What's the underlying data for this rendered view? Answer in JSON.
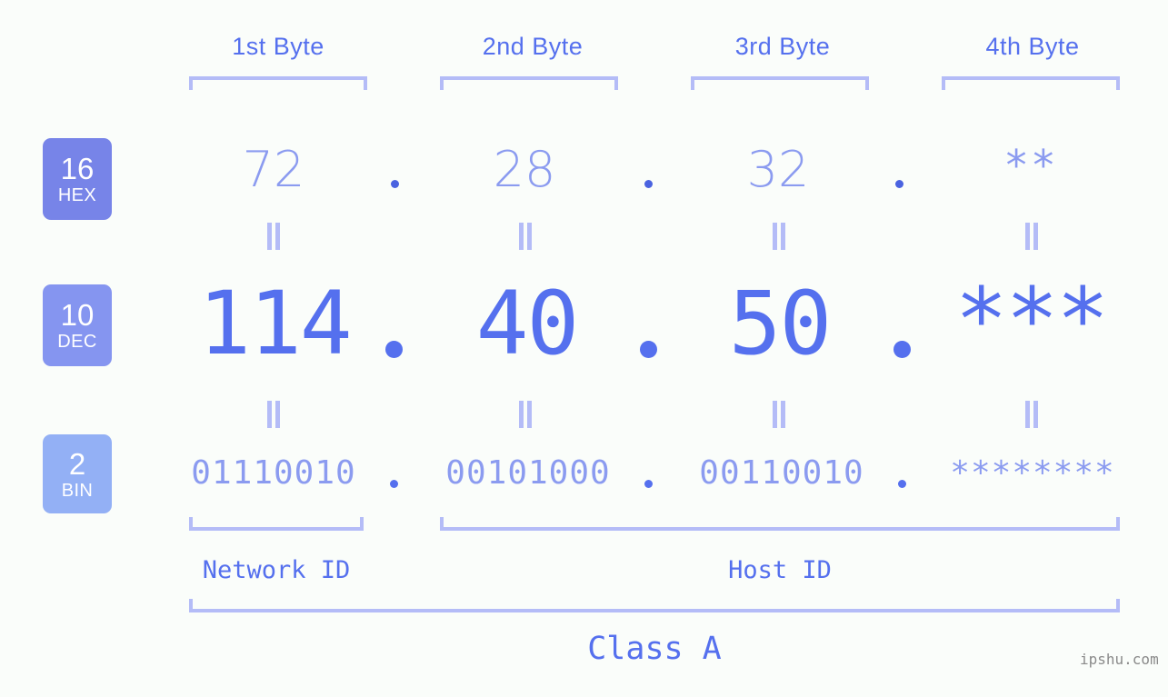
{
  "background_color": "#fafdfa",
  "colors": {
    "accent_strong": "#5570ee",
    "accent_light": "#8b9bf0",
    "bracket": "#b4bcf7",
    "badge_hex": "#7784e8",
    "badge_dec": "#8595f0",
    "badge_bin": "#93b0f5",
    "watermark": "#8a8a8a"
  },
  "header": {
    "byte_labels": [
      {
        "text": "1st Byte"
      },
      {
        "text": "2nd Byte"
      },
      {
        "text": "3rd Byte"
      },
      {
        "text": "4th Byte"
      }
    ]
  },
  "rows": [
    {
      "badge": {
        "num": "16",
        "sub": "HEX"
      },
      "values": [
        "72",
        "28",
        "32",
        "**"
      ],
      "separator": "."
    },
    {
      "badge": {
        "num": "10",
        "sub": "DEC"
      },
      "values": [
        "114",
        "40",
        "50",
        "***"
      ],
      "separator": "."
    },
    {
      "badge": {
        "num": "2",
        "sub": "BIN"
      },
      "values": [
        "01110010",
        "00101000",
        "00110010",
        "********"
      ],
      "separator": "."
    }
  ],
  "equals_separator": "=",
  "footer": {
    "network_id_label": "Network ID",
    "host_id_label": "Host ID",
    "class_label": "Class A",
    "watermark": "ipshu.com"
  }
}
